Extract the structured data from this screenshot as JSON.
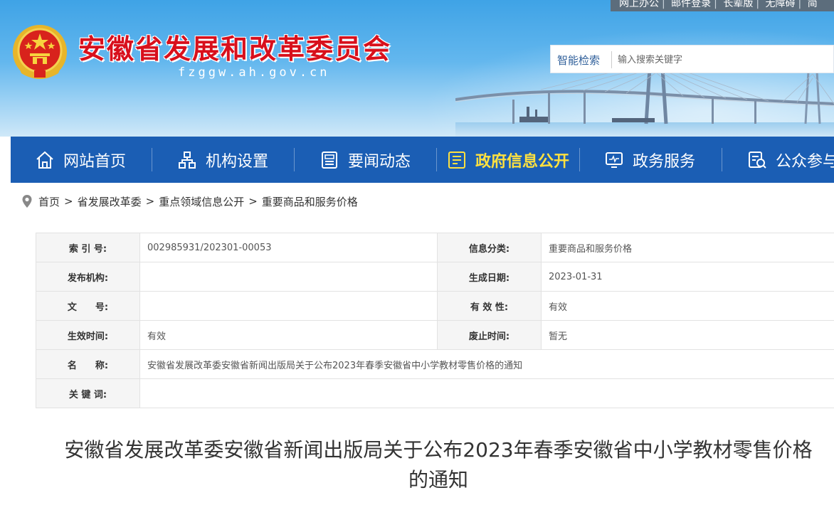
{
  "header": {
    "site_title": "安徽省发展和改革委员会",
    "site_domain": "fzggw.ah.gov.cn",
    "emblem_icon": "national-emblem-icon",
    "top_links": [
      "网上办公",
      "邮件登录",
      "长辈版",
      "无障碍",
      "简"
    ],
    "search": {
      "label": "智能检索",
      "placeholder": "输入搜索关键字"
    }
  },
  "nav": {
    "items": [
      {
        "label": "网站首页",
        "icon": "home-icon"
      },
      {
        "label": "机构设置",
        "icon": "org-chart-icon"
      },
      {
        "label": "要闻动态",
        "icon": "news-icon"
      },
      {
        "label": "政府信息公开",
        "icon": "info-disclosure-icon",
        "active": true
      },
      {
        "label": "政务服务",
        "icon": "monitor-service-icon"
      },
      {
        "label": "公众参与",
        "icon": "participation-icon"
      }
    ]
  },
  "breadcrumb": {
    "icon": "location-pin-icon",
    "items": [
      "首页",
      "省发展改革委",
      "重点领域信息公开",
      "重要商品和服务价格"
    ]
  },
  "info_table": {
    "index_label": "索 引 号:",
    "index_value": "002985931/202301-00053",
    "category_label": "信息分类:",
    "category_value": "重要商品和服务价格",
    "publisher_label": "发布机构:",
    "publisher_value": "",
    "date_label": "生成日期:",
    "date_value": "2023-01-31",
    "docno_label": "文　　号:",
    "docno_value": "",
    "validity_label": "有 效 性:",
    "validity_value": "有效",
    "effective_label": "生效时间:",
    "effective_value": "有效",
    "expire_label": "废止时间:",
    "expire_value": "暂无",
    "name_label": "名　　称:",
    "name_value": "安徽省发展改革委安徽省新闻出版局关于公布2023年春季安徽省中小学教材零售价格的通知",
    "keywords_label": "关 键 词:",
    "keywords_value": ""
  },
  "article": {
    "title": "安徽省发展改革委安徽省新闻出版局关于公布2023年春季安徽省中小学教材零售价格的通知"
  },
  "colors": {
    "brand_red": "#d8101c",
    "nav_blue": "#1b5eb4",
    "nav_active": "#ffe13f",
    "sky_blue": "#3fa3e6"
  }
}
